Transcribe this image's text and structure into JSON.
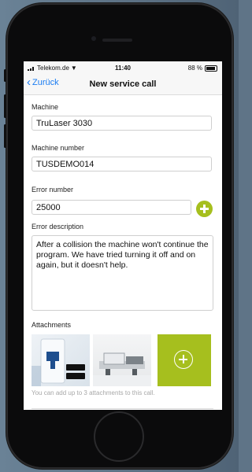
{
  "status": {
    "carrier": "Telekom.de",
    "time": "11:40",
    "battery": "88 %"
  },
  "nav": {
    "back_label": "Zurück",
    "title": "New service call"
  },
  "form": {
    "machine_label": "Machine",
    "machine_value": "TruLaser 3030",
    "machine_number_label": "Machine number",
    "machine_number_value": "TUSDEMO014",
    "error_number_label": "Error number",
    "error_number_value": "25000",
    "error_description_label": "Error description",
    "error_description_value": "After a collision the machine won't continue the program. We have tried turning it off and on again, but it doesn't help."
  },
  "attachments": {
    "label": "Attachments",
    "hint": "You can add up to 3 attachments to this call.",
    "accent_color": "#a6bf1e"
  },
  "colors": {
    "link": "#1a7cf2",
    "accent": "#a6bf1e"
  }
}
